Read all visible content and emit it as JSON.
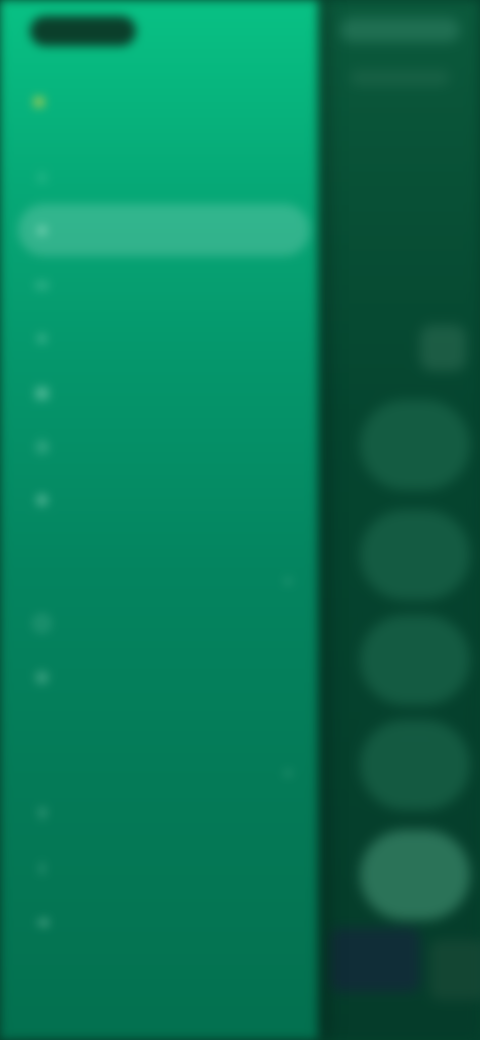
{
  "drawer": {
    "brand": "",
    "account_name": "",
    "nav_items": [
      {
        "label": "",
        "icon": "home-icon"
      },
      {
        "label": "",
        "icon": "star-icon"
      },
      {
        "label": "",
        "icon": "folder-icon"
      },
      {
        "label": "",
        "icon": "list-icon"
      },
      {
        "label": "",
        "icon": "chart-icon"
      },
      {
        "label": "",
        "icon": "clock-icon"
      },
      {
        "label": "",
        "icon": "gear-icon"
      }
    ],
    "section_one": {
      "title": "",
      "items": [
        {
          "label": "",
          "icon": "user-icon"
        },
        {
          "label": "",
          "icon": "users-icon"
        }
      ]
    },
    "section_two": {
      "title": "",
      "items": [
        {
          "label": "",
          "icon": "help-icon"
        },
        {
          "label": "",
          "icon": "info-icon"
        },
        {
          "label": "",
          "icon": "logout-icon"
        }
      ]
    }
  },
  "colors": {
    "drawer_top": "#08c184",
    "drawer_bottom": "#03704f",
    "backdrop": "#05402c",
    "active_highlight": "rgba(255,255,255,.18)"
  }
}
